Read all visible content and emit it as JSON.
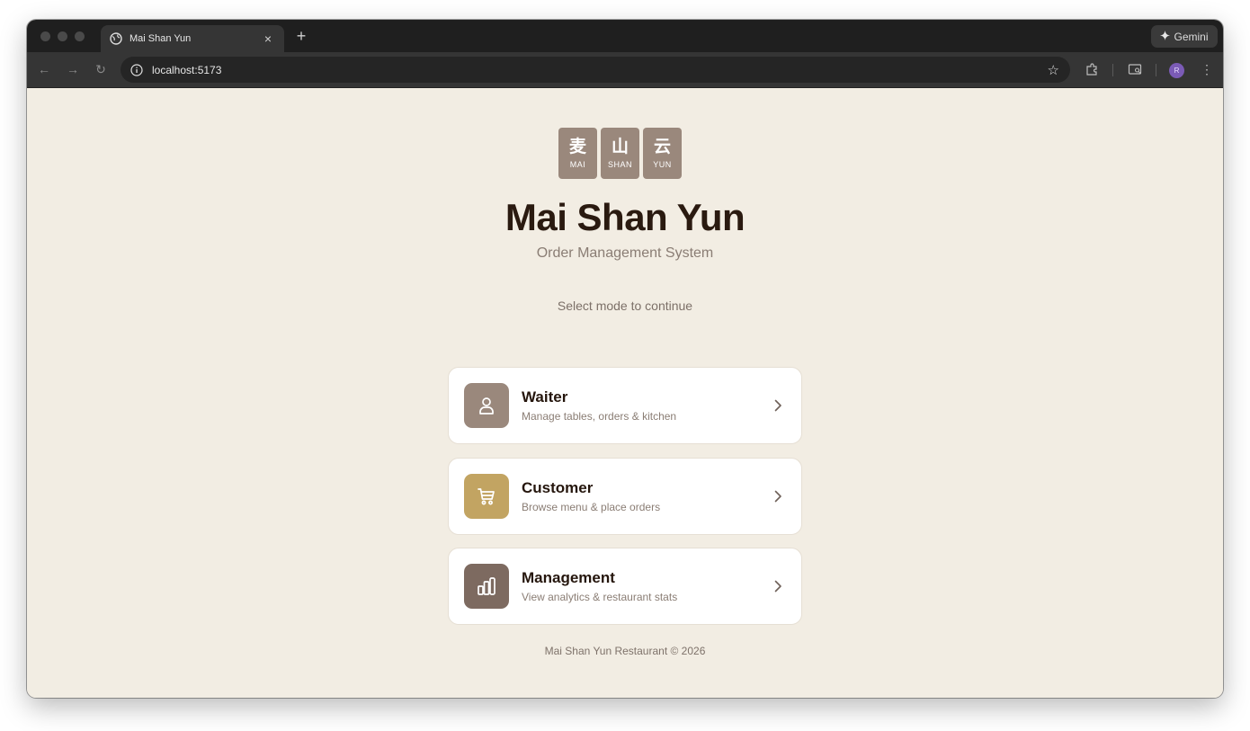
{
  "browser": {
    "tab_title": "Mai Shan Yun",
    "tab_close": "×",
    "new_tab": "+",
    "gemini_label": "Gemini",
    "url": "localhost:5173",
    "avatar_initial": "R"
  },
  "logo": {
    "tiles": [
      {
        "char": "麦",
        "sub": "MAI"
      },
      {
        "char": "山",
        "sub": "SHAN"
      },
      {
        "char": "云",
        "sub": "YUN"
      }
    ]
  },
  "header": {
    "title": "Mai Shan Yun",
    "subtitle": "Order Management System",
    "prompt": "Select mode to continue"
  },
  "modes": [
    {
      "title": "Waiter",
      "description": "Manage tables, orders & kitchen",
      "icon": "user-icon",
      "color": "#9a887c"
    },
    {
      "title": "Customer",
      "description": "Browse menu & place orders",
      "icon": "cart-icon",
      "color": "#c2a462"
    },
    {
      "title": "Management",
      "description": "View analytics & restaurant stats",
      "icon": "bar-chart-icon",
      "color": "#7d6a60"
    }
  ],
  "footer": {
    "text": "Mai Shan Yun Restaurant © 2026"
  }
}
